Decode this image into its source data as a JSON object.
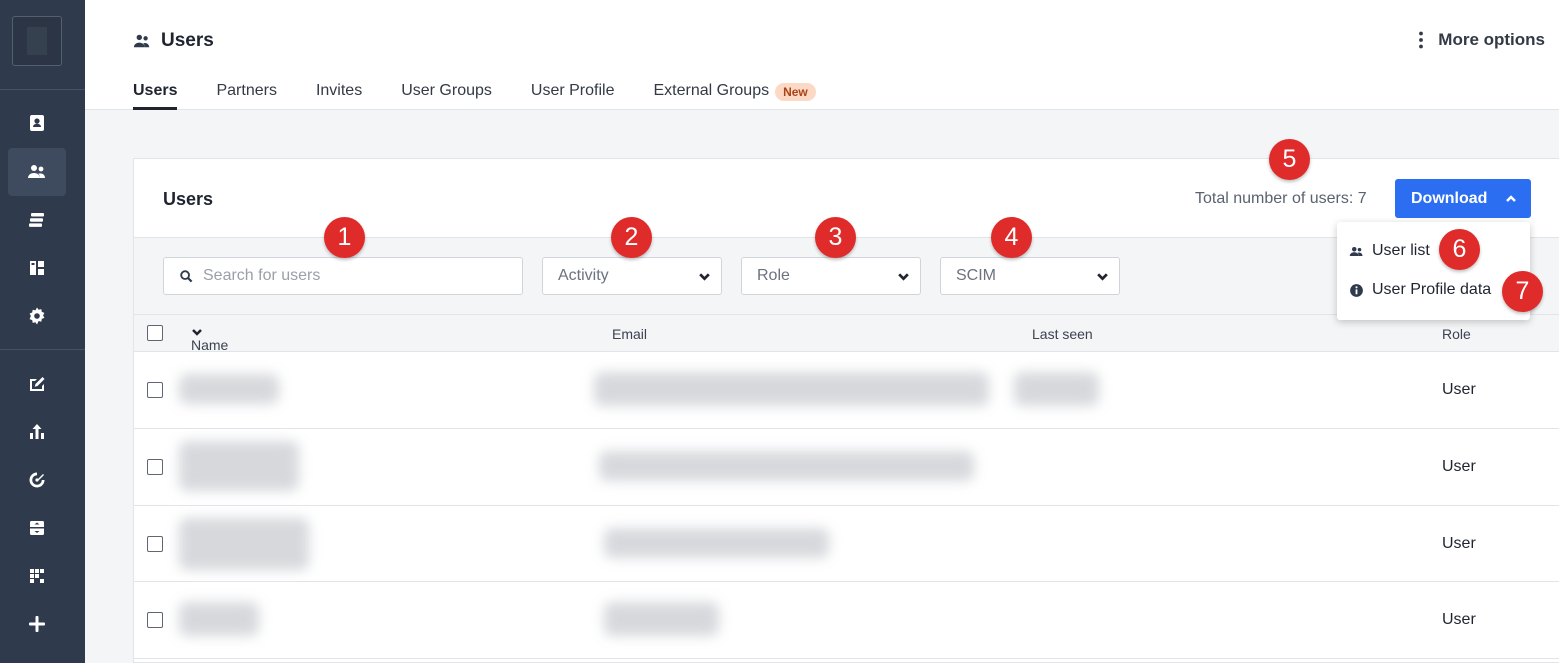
{
  "header": {
    "title": "Users",
    "more_options": "More options"
  },
  "tabs": [
    {
      "label": "Users",
      "active": true
    },
    {
      "label": "Partners"
    },
    {
      "label": "Invites"
    },
    {
      "label": "User Groups"
    },
    {
      "label": "User Profile"
    },
    {
      "label": "External Groups",
      "badge": "New"
    }
  ],
  "card": {
    "title": "Users",
    "total_label": "Total number of users: 7",
    "download_label": "Download"
  },
  "filters": {
    "search_placeholder": "Search for users",
    "activity": "Activity",
    "role": "Role",
    "scim": "SCIM"
  },
  "columns": {
    "name": "Name",
    "email": "Email",
    "last_seen": "Last seen",
    "role": "Role"
  },
  "rows": [
    {
      "role": "User"
    },
    {
      "role": "User"
    },
    {
      "role": "User"
    },
    {
      "role": "User"
    }
  ],
  "download_menu": {
    "user_list": "User list",
    "user_profile_data": "User Profile data"
  },
  "callouts": [
    "1",
    "2",
    "3",
    "4",
    "5",
    "6",
    "7"
  ],
  "colors": {
    "sidebar": "#2f3a4c",
    "accent": "#2c6ef2",
    "callout": "#e02b2b",
    "badge_bg": "#fcd9c4"
  }
}
